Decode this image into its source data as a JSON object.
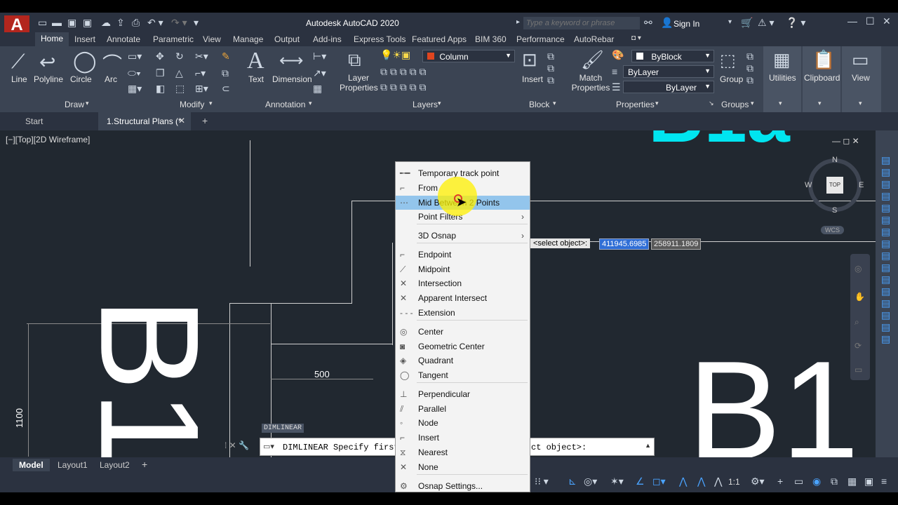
{
  "app": {
    "title": "Autodesk AutoCAD 2020",
    "search_placeholder": "Type a keyword or phrase",
    "sign_in": "Sign In",
    "logo_letter": "A"
  },
  "ribbon_tabs": [
    "Home",
    "Insert",
    "Annotate",
    "Parametric",
    "View",
    "Manage",
    "Output",
    "Add-ins",
    "Express Tools",
    "Featured Apps",
    "BIM 360",
    "Performance",
    "AutoRebar"
  ],
  "panels": {
    "draw": {
      "label": "Draw",
      "tools": [
        "Line",
        "Polyline",
        "Circle",
        "Arc"
      ]
    },
    "modify": {
      "label": "Modify"
    },
    "annotation": {
      "label": "Annotation",
      "tools": [
        "Text",
        "Dimension"
      ]
    },
    "layers": {
      "label": "Layers",
      "layer_props": "Layer\nProperties",
      "current_layer": "Column"
    },
    "block": {
      "label": "Block",
      "insert": "Insert"
    },
    "properties": {
      "label": "Properties",
      "match": "Match\nProperties",
      "color": "ByBlock",
      "linetype": "ByLayer",
      "lineweight": "ByLayer"
    },
    "groups": {
      "label": "Groups",
      "group": "Group"
    },
    "utilities": {
      "label": "Utilities"
    },
    "clipboard": {
      "label": "Clipboard"
    },
    "view": {
      "label": "View"
    }
  },
  "doc_tabs": {
    "start": "Start",
    "active": "1.Structural Plans (*"
  },
  "viewport": {
    "label": "[−][Top][2D Wireframe]",
    "viewcube": {
      "top": "TOP",
      "n": "N",
      "s": "S",
      "e": "E",
      "w": "W",
      "wcs": "WCS"
    },
    "dim_text": "500",
    "dim_vertical": "1100",
    "big_left": "B1",
    "big_right": "B1",
    "big_top": "B1a",
    "dimlinear_tag": "DIMLINEAR",
    "tooltip": {
      "prompt": "<select object>:",
      "x": "411945.6985",
      "y": "258911.1809"
    }
  },
  "command_line": {
    "text": "DIMLINEAR Specify first e",
    "text2": "ct object>:"
  },
  "layout_tabs": [
    "Model",
    "Layout1",
    "Layout2"
  ],
  "status": {
    "scale": "1:1"
  },
  "context_menu": [
    {
      "label": "Temporary track point",
      "icon": "track-icon"
    },
    {
      "label": "From",
      "icon": "from-icon"
    },
    {
      "label": "Mid Between 2 Points",
      "icon": "mid-icon",
      "highlighted": true
    },
    {
      "label": "Point Filters",
      "icon": "",
      "submenu": true
    },
    {
      "label": "3D Osnap",
      "icon": "",
      "submenu": true
    },
    {
      "label": "Endpoint",
      "icon": "endpoint-icon"
    },
    {
      "label": "Midpoint",
      "icon": "midpoint-icon"
    },
    {
      "label": "Intersection",
      "icon": "intersection-icon"
    },
    {
      "label": "Apparent Intersect",
      "icon": "apparent-icon"
    },
    {
      "label": "Extension",
      "icon": "extension-icon"
    },
    {
      "label": "Center",
      "icon": "center-icon"
    },
    {
      "label": "Geometric Center",
      "icon": "geocenter-icon"
    },
    {
      "label": "Quadrant",
      "icon": "quadrant-icon"
    },
    {
      "label": "Tangent",
      "icon": "tangent-icon"
    },
    {
      "label": "Perpendicular",
      "icon": "perpendicular-icon"
    },
    {
      "label": "Parallel",
      "icon": "parallel-icon"
    },
    {
      "label": "Node",
      "icon": "node-icon"
    },
    {
      "label": "Insert",
      "icon": "insert-icon"
    },
    {
      "label": "Nearest",
      "icon": "nearest-icon"
    },
    {
      "label": "None",
      "icon": "none-icon"
    },
    {
      "label": "Osnap Settings...",
      "icon": "settings-icon"
    }
  ]
}
